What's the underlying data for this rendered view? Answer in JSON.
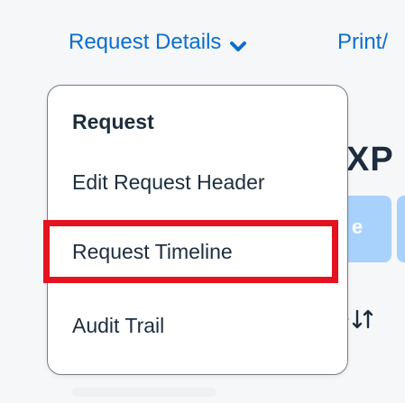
{
  "nav": {
    "request_details": "Request Details",
    "print": "Print/"
  },
  "menu": {
    "heading": "Request",
    "items": [
      {
        "label": "Edit Request Header"
      },
      {
        "label": "Request Timeline"
      },
      {
        "label": "Audit Trail"
      }
    ]
  },
  "background": {
    "title_fragment": "XP",
    "button_fragment": "e",
    "sort_fragment": "e"
  },
  "colors": {
    "accent": "#0a6ed1",
    "highlight": "#e5131f",
    "button_bg": "#a8d2fb",
    "text": "#1d2d3e"
  },
  "icons": {
    "dropdown": "chevron-down-icon",
    "sort": "sort-icon"
  }
}
